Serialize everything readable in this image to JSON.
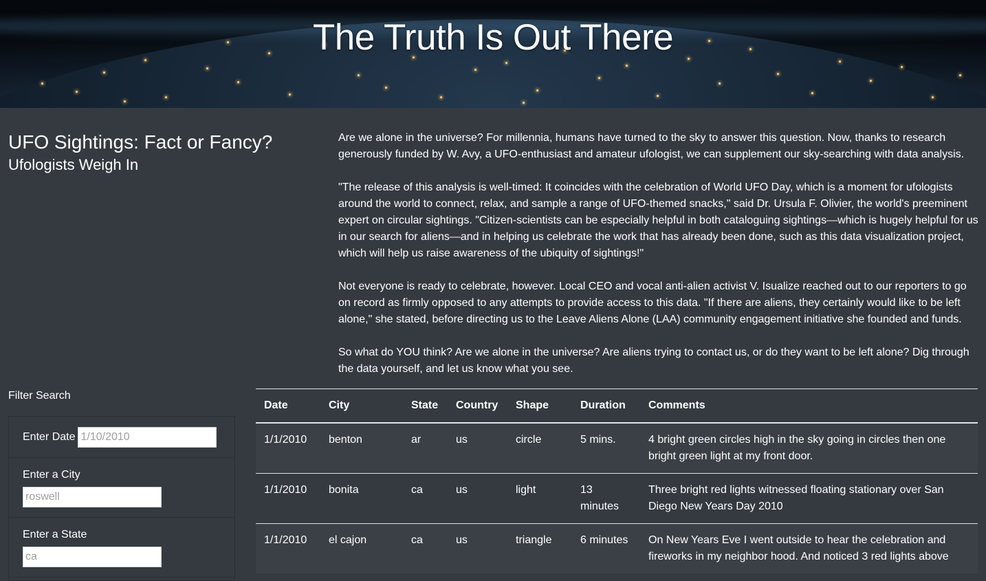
{
  "hero": {
    "title": "The Truth Is Out There"
  },
  "intro": {
    "heading": "UFO Sightings: Fact or Fancy?",
    "subheading": "Ufologists Weigh In",
    "paragraphs": [
      "Are we alone in the universe? For millennia, humans have turned to the sky to answer this question. Now, thanks to research generously funded by W. Avy, a UFO-enthusiast and amateur ufologist, we can supplement our sky-searching with data analysis.",
      "\"The release of this analysis is well-timed: It coincides with the celebration of World UFO Day, which is a moment for ufologists around the world to connect, relax, and sample a range of UFO-themed snacks,\" said Dr. Ursula F. Olivier, the world's preeminent expert on circular sightings. \"Citizen-scientists can be especially helpful in both cataloguing sightings—which is hugely helpful for us in our search for aliens—and in helping us celebrate the work that has already been done, such as this data visualization project, which will help us raise awareness of the ubiquity of sightings!\"",
      "Not everyone is ready to celebrate, however. Local CEO and vocal anti-alien activist V. Isualize reached out to our reporters to go on record as firmly opposed to any attempts to provide access to this data. \"If there are aliens, they certainly would like to be left alone,\" she stated, before directing us to the Leave Aliens Alone (LAA) community engagement initiative she founded and funds.",
      "So what do YOU think? Are we alone in the universe? Are aliens trying to contact us, or do they want to be left alone? Dig through the data yourself, and let us know what you see."
    ]
  },
  "filter": {
    "title": "Filter Search",
    "date": {
      "label": "Enter Date",
      "placeholder": "1/10/2010"
    },
    "city": {
      "label": "Enter a City",
      "placeholder": "roswell"
    },
    "state": {
      "label": "Enter a State",
      "placeholder": "ca"
    }
  },
  "table": {
    "headers": {
      "date": "Date",
      "city": "City",
      "state": "State",
      "country": "Country",
      "shape": "Shape",
      "duration": "Duration",
      "comments": "Comments"
    },
    "rows": [
      {
        "date": "1/1/2010",
        "city": "benton",
        "state": "ar",
        "country": "us",
        "shape": "circle",
        "duration": "5 mins.",
        "comments": "4 bright green circles high in the sky going in circles then one bright green light at my front door."
      },
      {
        "date": "1/1/2010",
        "city": "bonita",
        "state": "ca",
        "country": "us",
        "shape": "light",
        "duration": "13 minutes",
        "comments": "Three bright red lights witnessed floating stationary over San Diego New Years Day 2010"
      },
      {
        "date": "1/1/2010",
        "city": "el cajon",
        "state": "ca",
        "country": "us",
        "shape": "triangle",
        "duration": "6 minutes",
        "comments": "On New Years Eve I went outside to hear the celebration and fireworks in my neighbor hood. And noticed 3 red lights above"
      }
    ]
  }
}
